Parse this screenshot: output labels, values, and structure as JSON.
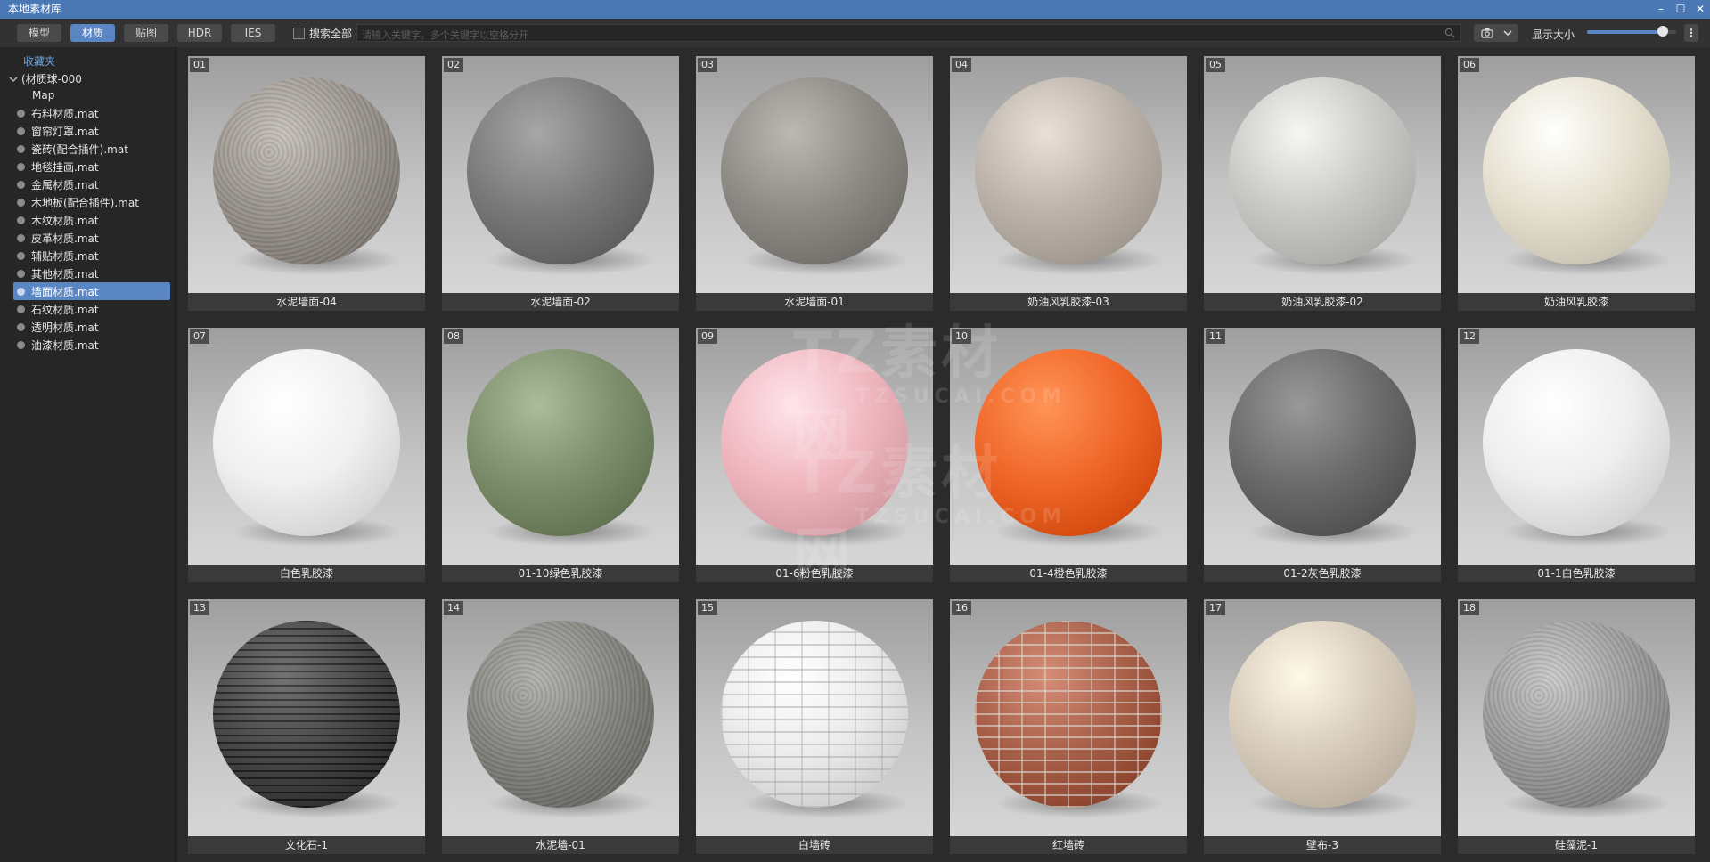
{
  "window": {
    "title": "本地素材库"
  },
  "toolbar": {
    "tabs": [
      {
        "label": "模型",
        "active": false
      },
      {
        "label": "材质",
        "active": true
      },
      {
        "label": "贴图",
        "active": false
      },
      {
        "label": "HDR",
        "active": false
      },
      {
        "label": "IES",
        "active": false
      }
    ],
    "search_all_label": "搜索全部",
    "search_placeholder": "请输入关键字，多个关键字以空格分开",
    "display_size_label": "显示大小",
    "display_size_value": 0.85,
    "more_label": "⋮"
  },
  "sidebar": {
    "favorites": "收藏夹",
    "root": "(材质球-000",
    "map": "Map",
    "items": [
      {
        "label": "布料材质.mat",
        "selected": false
      },
      {
        "label": "窗帘灯罩.mat",
        "selected": false
      },
      {
        "label": "瓷砖(配合插件).mat",
        "selected": false
      },
      {
        "label": "地毯挂画.mat",
        "selected": false
      },
      {
        "label": "金属材质.mat",
        "selected": false
      },
      {
        "label": "木地板(配合插件).mat",
        "selected": false
      },
      {
        "label": "木纹材质.mat",
        "selected": false
      },
      {
        "label": "皮革材质.mat",
        "selected": false
      },
      {
        "label": "辅贴材质.mat",
        "selected": false
      },
      {
        "label": "其他材质.mat",
        "selected": false
      },
      {
        "label": "墙面材质.mat",
        "selected": true
      },
      {
        "label": "石纹材质.mat",
        "selected": false
      },
      {
        "label": "透明材质.mat",
        "selected": false
      },
      {
        "label": "油漆材质.mat",
        "selected": false
      }
    ]
  },
  "materials": [
    {
      "num": "01",
      "label": "水泥墙面-04",
      "color": "#9a948e",
      "style": "stone"
    },
    {
      "num": "02",
      "label": "水泥墙面-02",
      "color": "#7a7a7a",
      "style": "plain"
    },
    {
      "num": "03",
      "label": "水泥墙面-01",
      "color": "#8f8b86",
      "style": "plain"
    },
    {
      "num": "04",
      "label": "奶油风乳胶漆-03",
      "color": "#bcb3aa",
      "style": "plain"
    },
    {
      "num": "05",
      "label": "奶油风乳胶漆-02",
      "color": "#c9c9c5",
      "style": "plain"
    },
    {
      "num": "06",
      "label": "奶油风乳胶漆",
      "color": "#e6e0d0",
      "style": "plain"
    },
    {
      "num": "07",
      "label": "白色乳胶漆",
      "color": "#f0f0f0",
      "style": "plain"
    },
    {
      "num": "08",
      "label": "01-10绿色乳胶漆",
      "color": "#7e8f6e",
      "style": "plain"
    },
    {
      "num": "09",
      "label": "01-6粉色乳胶漆",
      "color": "#f0b7bf",
      "style": "plain"
    },
    {
      "num": "10",
      "label": "01-4橙色乳胶漆",
      "color": "#f0672a",
      "style": "plain"
    },
    {
      "num": "11",
      "label": "01-2灰色乳胶漆",
      "color": "#6c6c6c",
      "style": "plain"
    },
    {
      "num": "12",
      "label": "01-1白色乳胶漆",
      "color": "#eeeeee",
      "style": "plain"
    },
    {
      "num": "13",
      "label": "文化石-1",
      "color": "#3a3a3a",
      "style": "stack"
    },
    {
      "num": "14",
      "label": "水泥墙-01",
      "color": "#858580",
      "style": "stone"
    },
    {
      "num": "15",
      "label": "白墙砖",
      "color": "#ececec",
      "style": "brick"
    },
    {
      "num": "16",
      "label": "红墙砖",
      "color": "#a8604a",
      "style": "redbrick"
    },
    {
      "num": "17",
      "label": "壁布-3",
      "color": "#d8ccbc",
      "style": "plain"
    },
    {
      "num": "18",
      "label": "硅藻泥-1",
      "color": "#9c9c9c",
      "style": "stone"
    }
  ],
  "watermark": {
    "brand": "TZ素材网",
    "domain": "TZSUCAI.COM"
  },
  "colors": {
    "accent": "#5b86c4",
    "titlebar": "#4a78b5",
    "background": "#2b2b2b"
  },
  "icons": {
    "camera": "camera-icon",
    "search": "search-icon"
  }
}
